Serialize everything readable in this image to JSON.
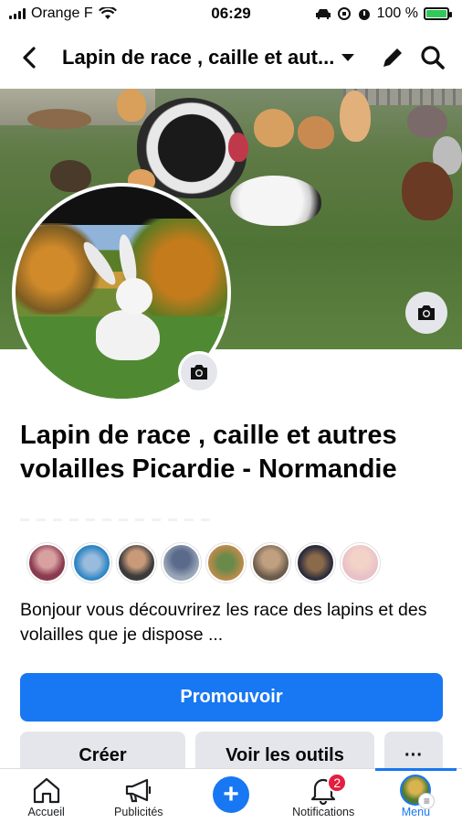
{
  "status_bar": {
    "carrier": "Orange F",
    "time": "06:29",
    "battery": "100 %"
  },
  "header": {
    "title": "Lapin de race , caille et aut...",
    "icons": [
      "back-arrow-icon",
      "caret-down-icon",
      "pencil-icon",
      "search-icon"
    ]
  },
  "cover": {
    "camera_icon": "camera-icon"
  },
  "profile": {
    "camera_icon": "camera-icon"
  },
  "page": {
    "name": "Lapin de race , caille et autres volailles Picardie - Normandie",
    "description": "Bonjour vous découvrirez les race des lapins et des volailles que je dispose ..."
  },
  "followers": {
    "count_shown": 8,
    "colors": [
      "#8a3b4f",
      "#2f86c4",
      "#3b3b3b",
      "#9aa7b8",
      "#b88a4a",
      "#6a5a4a",
      "#2b2b3b",
      "#e8c0c8"
    ]
  },
  "actions": {
    "promote": "Promouvoir",
    "create": "Créer",
    "tools": "Voir les outils",
    "more": "···"
  },
  "tabbar": {
    "home": "Accueil",
    "ads": "Publicités",
    "create_icon": "+",
    "notifications": "Notifications",
    "notifications_badge": "2",
    "menu": "Menu"
  },
  "colors": {
    "accent": "#1877f2",
    "badge": "#e41e3f",
    "button_gray": "#e4e6eb"
  }
}
